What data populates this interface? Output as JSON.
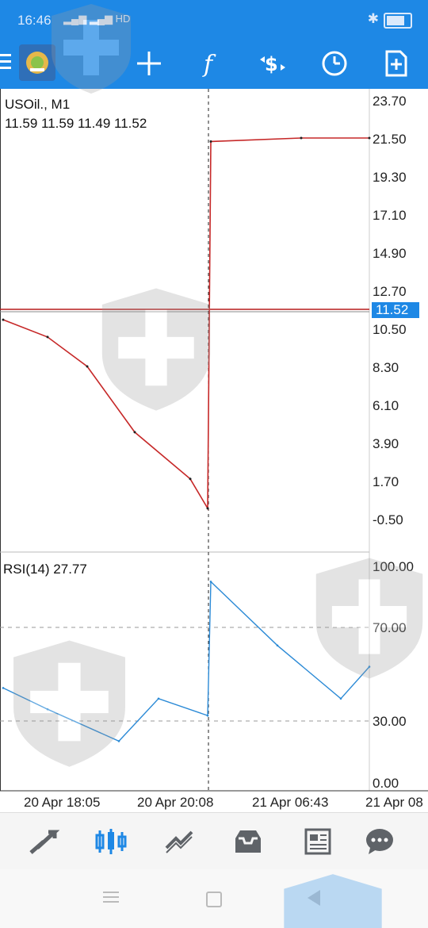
{
  "status_bar": {
    "time": "16:46",
    "network": "HD"
  },
  "toolbar": {
    "items": [
      "menu-icon",
      "app-logo",
      "crosshair-icon",
      "function-icon",
      "trade-icon",
      "clock-icon",
      "new-order-icon"
    ]
  },
  "chart": {
    "symbol_title": "USOil., M1",
    "ohlc": "11.59 11.59 11.49 11.52",
    "current_price": "11.52",
    "price_axis": [
      "23.70",
      "21.50",
      "19.30",
      "17.10",
      "14.90",
      "12.70",
      "10.50",
      "8.30",
      "6.10",
      "3.90",
      "1.70",
      "-0.50"
    ],
    "rsi_title": "RSI(14) 27.77",
    "rsi_axis": [
      "100.00",
      "70.00",
      "30.00",
      "0.00"
    ],
    "time_axis": [
      "20 Apr 18:05",
      "20 Apr 20:08",
      "21 Apr 06:43",
      "21 Apr 08"
    ]
  },
  "chart_data": {
    "type": "line",
    "title": "USOil., M1",
    "series": [
      {
        "name": "USOil., M1",
        "x": [
          "20 Apr 18:05",
          "20 Apr 18:35",
          "20 Apr 19:05",
          "20 Apr 19:35",
          "20 Apr 20:00",
          "20 Apr 20:08",
          "20 Apr 20:10",
          "21 Apr 06:43",
          "21 Apr 08:00"
        ],
        "values": [
          11.0,
          10.0,
          8.3,
          4.5,
          1.8,
          0.1,
          21.3,
          21.5,
          21.5
        ]
      }
    ],
    "rsi": {
      "name": "RSI(14)",
      "x": [
        "20 Apr 18:05",
        "20 Apr 18:35",
        "20 Apr 19:05",
        "20 Apr 19:35",
        "20 Apr 20:08",
        "20 Apr 20:10",
        "21 Apr 06:43",
        "21 Apr 07:30",
        "21 Apr 08:00"
      ],
      "values": [
        45,
        35,
        20,
        40,
        32,
        95,
        65,
        40,
        55
      ],
      "levels": [
        70,
        30
      ]
    },
    "ylim": [
      -0.5,
      23.7
    ],
    "rsi_ylim": [
      0,
      100
    ],
    "grid": false
  },
  "bottom_nav": {
    "items": [
      "quotes-icon",
      "chart-icon",
      "trade-icon",
      "history-icon",
      "news-icon",
      "chat-icon"
    ],
    "active": "chart-icon",
    "accent": "#1e88e5",
    "inactive_color": "#5f6368"
  }
}
